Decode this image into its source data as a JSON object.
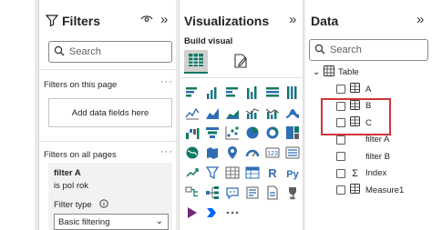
{
  "filters": {
    "title": "Filters",
    "search_placeholder": "Search",
    "section_page": "Filters on this page",
    "add_fields": "Add data fields here",
    "section_all": "Filters on all pages",
    "card": {
      "name": "filter A",
      "value": "is pol rok",
      "type_label": "Filter type",
      "type_value": "Basic filtering"
    }
  },
  "visualizations": {
    "title": "Visualizations",
    "subtitle": "Build visual",
    "icons": [
      "stacked-bar-chart",
      "stacked-column-chart",
      "clustered-bar-chart",
      "clustered-column-chart",
      "100-stacked-bar-chart",
      "100-stacked-column-chart",
      "line-chart",
      "area-chart",
      "stacked-area-chart",
      "line-and-stacked-column-chart",
      "line-and-clustered-column-chart",
      "ribbon-chart",
      "waterfall-chart",
      "funnel-chart",
      "scatter-chart",
      "pie-chart",
      "donut-chart",
      "treemap",
      "map",
      "filled-map",
      "azure-map",
      "gauge",
      "card",
      "multi-row-card",
      "kpi",
      "slicer",
      "table",
      "matrix",
      "r-visual",
      "python-visual",
      "key-influencers",
      "decomposition-tree",
      "qa",
      "smart-narrative",
      "paginated-report",
      "trophy-goals"
    ],
    "bottom_icons": [
      "power-apps",
      "power-automate",
      "more-visuals"
    ]
  },
  "data": {
    "title": "Data",
    "search_placeholder": "Search",
    "table_name": "Table",
    "fields": [
      {
        "label": "A",
        "type": "column"
      },
      {
        "label": "B",
        "type": "column"
      },
      {
        "label": "C",
        "type": "column"
      },
      {
        "label": "filter A",
        "type": "plain"
      },
      {
        "label": "filter B",
        "type": "plain"
      },
      {
        "label": "Index",
        "type": "sum"
      },
      {
        "label": "Measure1",
        "type": "column"
      }
    ]
  },
  "colors": {
    "accent": "#117865",
    "highlight": "#d13438",
    "icon_blue": "#2f6db5"
  }
}
